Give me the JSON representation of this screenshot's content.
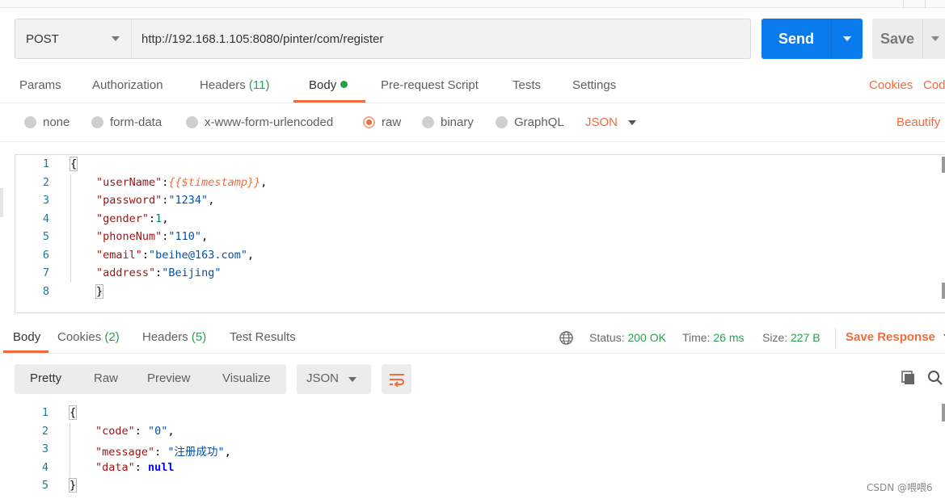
{
  "request": {
    "method": "POST",
    "url": "http://192.168.1.105:8080/pinter/com/register",
    "send_label": "Send",
    "save_label": "Save"
  },
  "request_tabs": [
    {
      "label": "Params"
    },
    {
      "label": "Authorization"
    },
    {
      "label": "Headers",
      "count": "(11)"
    },
    {
      "label": "Body"
    },
    {
      "label": "Pre-request Script"
    },
    {
      "label": "Tests"
    },
    {
      "label": "Settings"
    }
  ],
  "request_links": {
    "cookies": "Cookies",
    "code": "Code"
  },
  "body_types": [
    "none",
    "form-data",
    "x-www-form-urlencoded",
    "raw",
    "binary",
    "GraphQL"
  ],
  "body_type_selected": "raw",
  "language": "JSON",
  "beautify_label": "Beautify",
  "request_body": {
    "line_numbers": [
      "1",
      "2",
      "3",
      "4",
      "5",
      "6",
      "7",
      "8"
    ],
    "open": "{",
    "close": "}",
    "fields": [
      {
        "key": "\"userName\"",
        "value": "{{$timestamp}}"
      },
      {
        "key": "\"password\"",
        "value": "\"1234\""
      },
      {
        "key": "\"gender\"",
        "value": "1"
      },
      {
        "key": "\"phoneNum\"",
        "value": "\"110\""
      },
      {
        "key": "\"email\"",
        "value": "\"beihe@163.com\""
      },
      {
        "key": "\"address\"",
        "value": "\"Beijing\""
      }
    ]
  },
  "response_tabs": [
    {
      "label": "Body"
    },
    {
      "label": "Cookies",
      "count": "(2)"
    },
    {
      "label": "Headers",
      "count": "(5)"
    },
    {
      "label": "Test Results"
    }
  ],
  "response_status": {
    "status_label": "Status:",
    "status_value": "200 OK",
    "time_label": "Time:",
    "time_value": "26 ms",
    "size_label": "Size:",
    "size_value": "227 B"
  },
  "save_response_label": "Save Response",
  "view_modes": [
    "Pretty",
    "Raw",
    "Preview",
    "Visualize"
  ],
  "response_language": "JSON",
  "response_body": {
    "line_numbers": [
      "1",
      "2",
      "3",
      "4",
      "5"
    ],
    "open": "{",
    "close": "}",
    "fields": [
      {
        "key": "\"code\"",
        "value": "\"0\""
      },
      {
        "key": "\"message\"",
        "value": "\"注册成功\""
      },
      {
        "key": "\"data\"",
        "value": "null"
      }
    ]
  },
  "watermark": "CSDN @喂喂6",
  "colors": {
    "accent": "#f26b3a",
    "send": "#097bed",
    "success": "#2a9f4c"
  }
}
